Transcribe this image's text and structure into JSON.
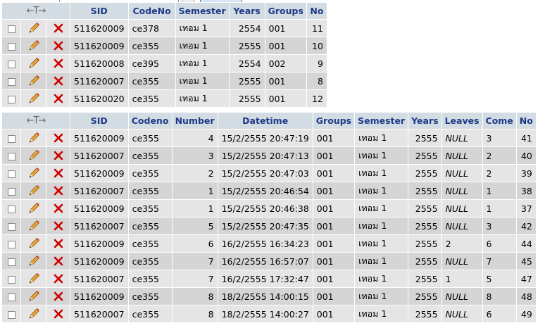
{
  "table1": {
    "headers": [
      "SID",
      "CodeNo",
      "Semester",
      "Years",
      "Groups",
      "No"
    ],
    "rows": [
      {
        "sid": "511620009",
        "code": "ce378",
        "semester": "เทอม 1",
        "years": "2554",
        "groups": "001",
        "no": "11"
      },
      {
        "sid": "511620009",
        "code": "ce355",
        "semester": "เทอม 1",
        "years": "2555",
        "groups": "001",
        "no": "10"
      },
      {
        "sid": "511620008",
        "code": "ce395",
        "semester": "เทอม 1",
        "years": "2554",
        "groups": "002",
        "no": "9"
      },
      {
        "sid": "511620007",
        "code": "ce355",
        "semester": "เทอม 1",
        "years": "2555",
        "groups": "001",
        "no": "8"
      },
      {
        "sid": "511620020",
        "code": "ce355",
        "semester": "เทอม 1",
        "years": "2555",
        "groups": "001",
        "no": "12"
      }
    ]
  },
  "table2": {
    "headers": [
      "SID",
      "Codeno",
      "Number",
      "Datetime",
      "Groups",
      "Semester",
      "Years",
      "Leaves",
      "Come",
      "No"
    ],
    "rows": [
      {
        "sid": "511620009",
        "code": "ce355",
        "number": "4",
        "datetime": "15/2/2555 20:47:19",
        "groups": "001",
        "semester": "เทอม 1",
        "years": "2555",
        "leaves": "NULL",
        "come": "3",
        "no": "41"
      },
      {
        "sid": "511620007",
        "code": "ce355",
        "number": "3",
        "datetime": "15/2/2555 20:47:13",
        "groups": "001",
        "semester": "เทอม 1",
        "years": "2555",
        "leaves": "NULL",
        "come": "2",
        "no": "40"
      },
      {
        "sid": "511620009",
        "code": "ce355",
        "number": "2",
        "datetime": "15/2/2555 20:47:03",
        "groups": "001",
        "semester": "เทอม 1",
        "years": "2555",
        "leaves": "NULL",
        "come": "2",
        "no": "39"
      },
      {
        "sid": "511620007",
        "code": "ce355",
        "number": "1",
        "datetime": "15/2/2555 20:46:54",
        "groups": "001",
        "semester": "เทอม 1",
        "years": "2555",
        "leaves": "NULL",
        "come": "1",
        "no": "38"
      },
      {
        "sid": "511620009",
        "code": "ce355",
        "number": "1",
        "datetime": "15/2/2555 20:46:38",
        "groups": "001",
        "semester": "เทอม 1",
        "years": "2555",
        "leaves": "NULL",
        "come": "1",
        "no": "37"
      },
      {
        "sid": "511620007",
        "code": "ce355",
        "number": "5",
        "datetime": "15/2/2555 20:47:35",
        "groups": "001",
        "semester": "เทอม 1",
        "years": "2555",
        "leaves": "NULL",
        "come": "3",
        "no": "42"
      },
      {
        "sid": "511620009",
        "code": "ce355",
        "number": "6",
        "datetime": "16/2/2555 16:34:23",
        "groups": "001",
        "semester": "เทอม 1",
        "years": "2555",
        "leaves": "2",
        "come": "6",
        "no": "44"
      },
      {
        "sid": "511620009",
        "code": "ce355",
        "number": "7",
        "datetime": "16/2/2555 16:57:07",
        "groups": "001",
        "semester": "เทอม 1",
        "years": "2555",
        "leaves": "NULL",
        "come": "7",
        "no": "45"
      },
      {
        "sid": "511620007",
        "code": "ce355",
        "number": "7",
        "datetime": "16/2/2555 17:32:47",
        "groups": "001",
        "semester": "เทอม 1",
        "years": "2555",
        "leaves": "1",
        "come": "5",
        "no": "47"
      },
      {
        "sid": "511620009",
        "code": "ce355",
        "number": "8",
        "datetime": "18/2/2555 14:00:15",
        "groups": "001",
        "semester": "เทอม 1",
        "years": "2555",
        "leaves": "NULL",
        "come": "8",
        "no": "48"
      },
      {
        "sid": "511620007",
        "code": "ce355",
        "number": "8",
        "datetime": "18/2/2555 14:00:27",
        "groups": "001",
        "semester": "เทอม 1",
        "years": "2555",
        "leaves": "NULL",
        "come": "6",
        "no": "49"
      }
    ]
  },
  "icons": {
    "edit": "pencil-icon",
    "delete": "delete-x-icon",
    "column_arrows": "←T→"
  },
  "colors": {
    "header_bg": "#d3dce3",
    "header_text": "#1f3b87",
    "row_odd": "#e5e5e5",
    "row_even": "#d5d5d5",
    "delete": "#cc0000"
  }
}
